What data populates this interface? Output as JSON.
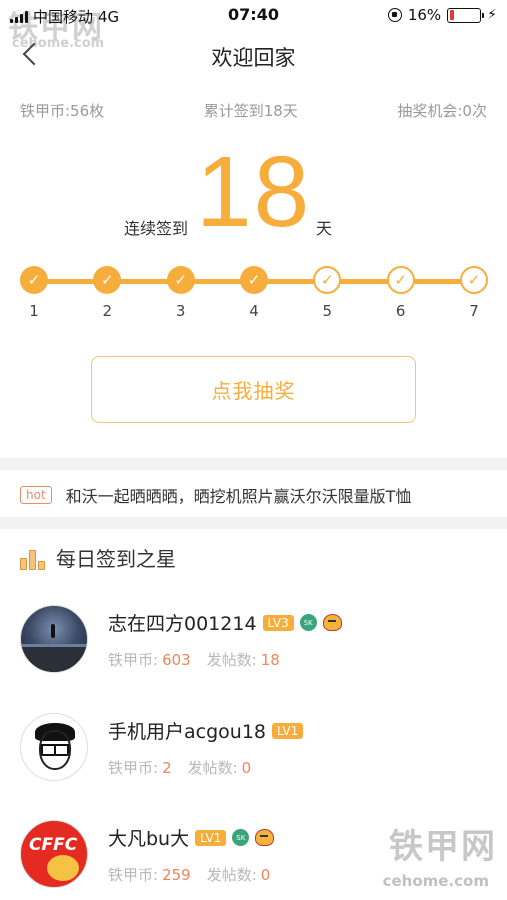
{
  "status_bar": {
    "carrier": "中国移动",
    "network": "4G",
    "time": "07:40",
    "battery": "16%",
    "battery_level": 0.16
  },
  "watermark": {
    "logo": "铁甲网",
    "site": "cehome.com"
  },
  "nav": {
    "title": "欢迎回家"
  },
  "stats": {
    "coins": "铁甲币:56枚",
    "total_checkins": "累计签到18天",
    "lottery_chances": "抽奖机会:0次"
  },
  "streak": {
    "label": "连续签到",
    "count": "18",
    "unit": "天"
  },
  "week_progress": {
    "days": [
      {
        "label": "1",
        "checked": true
      },
      {
        "label": "2",
        "checked": true
      },
      {
        "label": "3",
        "checked": true
      },
      {
        "label": "4",
        "checked": true
      },
      {
        "label": "5",
        "checked": false
      },
      {
        "label": "6",
        "checked": false
      },
      {
        "label": "7",
        "checked": false
      }
    ],
    "check_glyph": "✓"
  },
  "lottery_button": {
    "label": "点我抽奖"
  },
  "hot": {
    "badge": "hot",
    "text": "和沃一起晒晒晒，晒挖机照片赢沃尔沃限量版T恤"
  },
  "daily_stars": {
    "title": "每日签到之星",
    "coin_label": "铁甲币:",
    "posts_label": "发帖数:",
    "users": [
      {
        "name": "志在四方001214",
        "level": "LV3",
        "coins": "603",
        "posts": "18",
        "has_badges": true
      },
      {
        "name": "手机用户acgou18",
        "level": "LV1",
        "coins": "2",
        "posts": "0",
        "has_badges": false
      },
      {
        "name": "大凡bu大",
        "level": "LV1",
        "coins": "259",
        "posts": "0",
        "has_badges": true
      }
    ],
    "avatar3_text": "CFFC",
    "badge_text": "SK"
  },
  "colors": {
    "accent": "#f7ad3b",
    "value": "#f0845c",
    "muted": "#9a9a9a"
  }
}
